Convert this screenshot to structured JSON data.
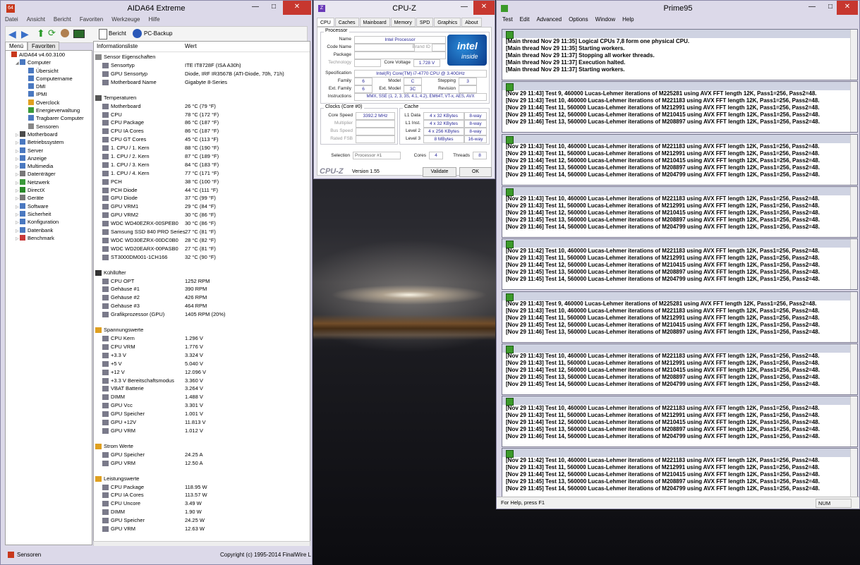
{
  "aida": {
    "title": "AIDA64 Extreme",
    "menu": [
      "Datei",
      "Ansicht",
      "Bericht",
      "Favoriten",
      "Werkzeuge",
      "Hilfe"
    ],
    "toolbar": {
      "report": "Bericht",
      "backup": "PC-Backup"
    },
    "tabs": [
      "Menü",
      "Favoriten"
    ],
    "tree": [
      {
        "label": "AIDA64 v4.60.3100",
        "level": 0,
        "expander": "",
        "color": "#c8381c"
      },
      {
        "label": "Computer",
        "level": 1,
        "expander": "◢",
        "color": "#4a78c0"
      },
      {
        "label": "Übersicht",
        "level": 2,
        "expander": "",
        "color": "#4a78c0"
      },
      {
        "label": "Computername",
        "level": 2,
        "expander": "",
        "color": "#4a78c0"
      },
      {
        "label": "DMI",
        "level": 2,
        "expander": "",
        "color": "#4a78c0"
      },
      {
        "label": "IPMI",
        "level": 2,
        "expander": "",
        "color": "#4a78c0"
      },
      {
        "label": "Overclock",
        "level": 2,
        "expander": "",
        "color": "#e0a020"
      },
      {
        "label": "Energieverwaltung",
        "level": 2,
        "expander": "",
        "color": "#3a9a3a"
      },
      {
        "label": "Tragbarer Computer",
        "level": 2,
        "expander": "",
        "color": "#4a78c0"
      },
      {
        "label": "Sensoren",
        "level": 2,
        "expander": "",
        "color": "#888888"
      },
      {
        "label": "Motherboard",
        "level": 1,
        "expander": "▷",
        "color": "#4a4a4a"
      },
      {
        "label": "Betriebssystem",
        "level": 1,
        "expander": "▷",
        "color": "#4a78c0"
      },
      {
        "label": "Server",
        "level": 1,
        "expander": "▷",
        "color": "#4a78c0"
      },
      {
        "label": "Anzeige",
        "level": 1,
        "expander": "▷",
        "color": "#4a78c0"
      },
      {
        "label": "Multimedia",
        "level": 1,
        "expander": "▷",
        "color": "#4a78c0"
      },
      {
        "label": "Datenträger",
        "level": 1,
        "expander": "▷",
        "color": "#777777"
      },
      {
        "label": "Netzwerk",
        "level": 1,
        "expander": "▷",
        "color": "#3a9a3a"
      },
      {
        "label": "DirectX",
        "level": 1,
        "expander": "▷",
        "color": "#2a8a2a"
      },
      {
        "label": "Geräte",
        "level": 1,
        "expander": "▷",
        "color": "#777777"
      },
      {
        "label": "Software",
        "level": 1,
        "expander": "▷",
        "color": "#4a78c0"
      },
      {
        "label": "Sicherheit",
        "level": 1,
        "expander": "▷",
        "color": "#4a78c0"
      },
      {
        "label": "Konfiguration",
        "level": 1,
        "expander": "▷",
        "color": "#4a78c0"
      },
      {
        "label": "Datenbank",
        "level": 1,
        "expander": "▷",
        "color": "#4a78c0"
      },
      {
        "label": "Benchmark",
        "level": 1,
        "expander": "▷",
        "color": "#c83838"
      }
    ],
    "columns": {
      "name": "Informationsliste",
      "value": "Wert"
    },
    "sections": [
      {
        "title": "Sensor Eigenschaften",
        "color": "#888888",
        "rows": [
          {
            "name": "Sensortyp",
            "value": "ITE IT8728F  (ISA A30h)"
          },
          {
            "name": "GPU Sensortyp",
            "value": "Diode, IRF IR3567B  (ATI-Diode, 70h, 71h)"
          },
          {
            "name": "Motherboard Name",
            "value": "Gigabyte 8-Series"
          }
        ]
      },
      {
        "title": "Temperaturen",
        "color": "#555555",
        "rows": [
          {
            "name": "Motherboard",
            "value": "26 °C  (79 °F)"
          },
          {
            "name": "CPU",
            "value": "78 °C  (172 °F)"
          },
          {
            "name": "CPU Package",
            "value": "86 °C  (187 °F)"
          },
          {
            "name": "CPU IA Cores",
            "value": "86 °C  (187 °F)"
          },
          {
            "name": "CPU GT Cores",
            "value": "45 °C  (113 °F)"
          },
          {
            "name": "1. CPU / 1. Kern",
            "value": "88 °C  (190 °F)"
          },
          {
            "name": "1. CPU / 2. Kern",
            "value": "87 °C  (189 °F)"
          },
          {
            "name": "1. CPU / 3. Kern",
            "value": "84 °C  (183 °F)"
          },
          {
            "name": "1. CPU / 4. Kern",
            "value": "77 °C  (171 °F)"
          },
          {
            "name": "PCH",
            "value": "38 °C  (100 °F)"
          },
          {
            "name": "PCH Diode",
            "value": "44 °C  (111 °F)"
          },
          {
            "name": "GPU Diode",
            "value": "37 °C  (99 °F)"
          },
          {
            "name": "GPU VRM1",
            "value": "29 °C  (84 °F)"
          },
          {
            "name": "GPU VRM2",
            "value": "30 °C  (86 °F)"
          },
          {
            "name": "WDC WD40EZRX-00SPEB0",
            "value": "30 °C  (86 °F)"
          },
          {
            "name": "Samsung SSD 840 PRO Series",
            "value": "27 °C  (81 °F)"
          },
          {
            "name": "WDC WD30EZRX-00DC0B0",
            "value": "28 °C  (82 °F)"
          },
          {
            "name": "WDC WD20EARX-00PASB0",
            "value": "27 °C  (81 °F)"
          },
          {
            "name": "ST3000DM001-1CH166",
            "value": "32 °C  (90 °F)"
          }
        ]
      },
      {
        "title": "Kühllüfter",
        "color": "#333333",
        "rows": [
          {
            "name": "CPU OPT",
            "value": "1252 RPM"
          },
          {
            "name": "Gehäuse #1",
            "value": "390 RPM"
          },
          {
            "name": "Gehäuse #2",
            "value": "426 RPM"
          },
          {
            "name": "Gehäuse #3",
            "value": "464 RPM"
          },
          {
            "name": "Grafikprozessor (GPU)",
            "value": "1405 RPM  (20%)"
          }
        ]
      },
      {
        "title": "Spannungswerte",
        "color": "#e0a020",
        "rows": [
          {
            "name": "CPU Kern",
            "value": "1.296 V"
          },
          {
            "name": "CPU VRM",
            "value": "1.776 V"
          },
          {
            "name": "+3.3 V",
            "value": "3.324 V"
          },
          {
            "name": "+5 V",
            "value": "5.040 V"
          },
          {
            "name": "+12 V",
            "value": "12.096 V"
          },
          {
            "name": "+3.3 V Bereitschaftsmodus",
            "value": "3.360 V"
          },
          {
            "name": "VBAT Batterie",
            "value": "3.264 V"
          },
          {
            "name": "DIMM",
            "value": "1.488 V"
          },
          {
            "name": "GPU Vcc",
            "value": "3.301 V"
          },
          {
            "name": "GPU Speicher",
            "value": "1.001 V"
          },
          {
            "name": "GPU +12V",
            "value": "11.813 V"
          },
          {
            "name": "GPU VRM",
            "value": "1.012 V"
          }
        ]
      },
      {
        "title": "Strom Werte",
        "color": "#e0a020",
        "rows": [
          {
            "name": "GPU Speicher",
            "value": "24.25 A"
          },
          {
            "name": "GPU VRM",
            "value": "12.50 A"
          }
        ]
      },
      {
        "title": "Leistungswerte",
        "color": "#e0a020",
        "rows": [
          {
            "name": "CPU Package",
            "value": "118.95 W"
          },
          {
            "name": "CPU IA Cores",
            "value": "113.57 W"
          },
          {
            "name": "CPU Uncore",
            "value": "3.49 W"
          },
          {
            "name": "DIMM",
            "value": "1.90 W"
          },
          {
            "name": "GPU Speicher",
            "value": "24.25 W"
          },
          {
            "name": "GPU VRM",
            "value": "12.63 W"
          }
        ]
      }
    ],
    "status_left": "Sensoren",
    "status_right": "Copyright (c) 1995-2014 FinalWire L"
  },
  "cpuz": {
    "title": "CPU-Z",
    "tabs": [
      "CPU",
      "Caches",
      "Mainboard",
      "Memory",
      "SPD",
      "Graphics",
      "About"
    ],
    "processor_group": "Processor",
    "name_label": "Name",
    "name": "Intel Processor",
    "codename_label": "Code Name",
    "brand_id_label": "Brand ID",
    "package_label": "Package",
    "technology_label": "Technology",
    "core_voltage_label": "Core Voltage",
    "core_voltage": "1.728 V",
    "spec_label": "Specification",
    "spec": "Intel(R) Core(TM) i7-4770 CPU @ 3.40GHz",
    "family_label": "Family",
    "family": "6",
    "model_label": "Model",
    "model": "C",
    "stepping_label": "Stepping",
    "stepping": "3",
    "ext_family_label": "Ext. Family",
    "ext_family": "6",
    "ext_model_label": "Ext. Model",
    "ext_model": "3C",
    "revision_label": "Revision",
    "instructions_label": "Instructions",
    "instructions": "MMX, SSE (1, 2, 3, 3S, 4.1, 4.2), EM64T, VT-x, AES, AVX",
    "clocks_group": "Clocks (Core #0)",
    "core_speed_label": "Core Speed",
    "core_speed": "3392.2 MHz",
    "multiplier_label": "Multiplier",
    "bus_speed_label": "Bus Speed",
    "rated_fsb_label": "Rated FSB",
    "cache_group": "Cache",
    "l1d_label": "L1 Data",
    "l1d": "4 x 32 KBytes",
    "l1d_way": "8-way",
    "l1i_label": "L1 Inst.",
    "l1i": "4 x 32 KBytes",
    "l1i_way": "8-way",
    "l2_label": "Level 2",
    "l2": "4 x 256 KBytes",
    "l2_way": "8-way",
    "l3_label": "Level 3",
    "l3": "8 MBytes",
    "l3_way": "16-way",
    "selection_label": "Selection",
    "selection": "Processor #1",
    "cores_label": "Cores",
    "cores": "4",
    "threads_label": "Threads",
    "threads": "8",
    "logo": "CPU-Z",
    "version": "Version 1.55",
    "validate": "Validate",
    "ok": "OK",
    "intel_line1": "intel",
    "intel_line2": "inside"
  },
  "prime": {
    "title": "Prime95",
    "menu": [
      "Test",
      "Edit",
      "Advanced",
      "Options",
      "Window",
      "Help"
    ],
    "windows": [
      {
        "lines": [
          "[Main thread Nov 29 11:35] Logical CPUs 7,8 form one physical CPU.",
          "[Main thread Nov 29 11:35] Starting workers.",
          "[Main thread Nov 29 11:37] Stopping all worker threads.",
          "[Main thread Nov 29 11:37] Execution halted.",
          "[Main thread Nov 29 11:37] Starting workers."
        ]
      },
      {
        "lines": [
          "[Nov 29 11:43] Test 9, 460000 Lucas-Lehmer iterations of M225281 using AVX FFT length 12K, Pass1=256, Pass2=48.",
          "[Nov 29 11:43] Test 10, 460000 Lucas-Lehmer iterations of M221183 using AVX FFT length 12K, Pass1=256, Pass2=48.",
          "[Nov 29 11:44] Test 11, 560000 Lucas-Lehmer iterations of M212991 using AVX FFT length 12K, Pass1=256, Pass2=48.",
          "[Nov 29 11:45] Test 12, 560000 Lucas-Lehmer iterations of M210415 using AVX FFT length 12K, Pass1=256, Pass2=48.",
          "[Nov 29 11:46] Test 13, 560000 Lucas-Lehmer iterations of M208897 using AVX FFT length 12K, Pass1=256, Pass2=48."
        ]
      },
      {
        "lines": [
          "[Nov 29 11:43] Test 10, 460000 Lucas-Lehmer iterations of M221183 using AVX FFT length 12K, Pass1=256, Pass2=48.",
          "[Nov 29 11:43] Test 11, 560000 Lucas-Lehmer iterations of M212991 using AVX FFT length 12K, Pass1=256, Pass2=48.",
          "[Nov 29 11:44] Test 12, 560000 Lucas-Lehmer iterations of M210415 using AVX FFT length 12K, Pass1=256, Pass2=48.",
          "[Nov 29 11:45] Test 13, 560000 Lucas-Lehmer iterations of M208897 using AVX FFT length 12K, Pass1=256, Pass2=48.",
          "[Nov 29 11:46] Test 14, 560000 Lucas-Lehmer iterations of M204799 using AVX FFT length 12K, Pass1=256, Pass2=48."
        ]
      },
      {
        "lines": [
          "[Nov 29 11:43] Test 10, 460000 Lucas-Lehmer iterations of M221183 using AVX FFT length 12K, Pass1=256, Pass2=48.",
          "[Nov 29 11:43] Test 11, 560000 Lucas-Lehmer iterations of M212991 using AVX FFT length 12K, Pass1=256, Pass2=48.",
          "[Nov 29 11:44] Test 12, 560000 Lucas-Lehmer iterations of M210415 using AVX FFT length 12K, Pass1=256, Pass2=48.",
          "[Nov 29 11:45] Test 13, 560000 Lucas-Lehmer iterations of M208897 using AVX FFT length 12K, Pass1=256, Pass2=48.",
          "[Nov 29 11:46] Test 14, 560000 Lucas-Lehmer iterations of M204799 using AVX FFT length 12K, Pass1=256, Pass2=48."
        ]
      },
      {
        "lines": [
          "[Nov 29 11:42] Test 10, 460000 Lucas-Lehmer iterations of M221183 using AVX FFT length 12K, Pass1=256, Pass2=48.",
          "[Nov 29 11:43] Test 11, 560000 Lucas-Lehmer iterations of M212991 using AVX FFT length 12K, Pass1=256, Pass2=48.",
          "[Nov 29 11:44] Test 12, 560000 Lucas-Lehmer iterations of M210415 using AVX FFT length 12K, Pass1=256, Pass2=48.",
          "[Nov 29 11:45] Test 13, 560000 Lucas-Lehmer iterations of M208897 using AVX FFT length 12K, Pass1=256, Pass2=48.",
          "[Nov 29 11:45] Test 14, 560000 Lucas-Lehmer iterations of M204799 using AVX FFT length 12K, Pass1=256, Pass2=48."
        ]
      },
      {
        "lines": [
          "[Nov 29 11:43] Test 9, 460000 Lucas-Lehmer iterations of M225281 using AVX FFT length 12K, Pass1=256, Pass2=48.",
          "[Nov 29 11:43] Test 10, 460000 Lucas-Lehmer iterations of M221183 using AVX FFT length 12K, Pass1=256, Pass2=48.",
          "[Nov 29 11:44] Test 11, 560000 Lucas-Lehmer iterations of M212991 using AVX FFT length 12K, Pass1=256, Pass2=48.",
          "[Nov 29 11:45] Test 12, 560000 Lucas-Lehmer iterations of M210415 using AVX FFT length 12K, Pass1=256, Pass2=48.",
          "[Nov 29 11:46] Test 13, 560000 Lucas-Lehmer iterations of M208897 using AVX FFT length 12K, Pass1=256, Pass2=48."
        ]
      },
      {
        "lines": [
          "[Nov 29 11:43] Test 10, 460000 Lucas-Lehmer iterations of M221183 using AVX FFT length 12K, Pass1=256, Pass2=48.",
          "[Nov 29 11:43] Test 11, 560000 Lucas-Lehmer iterations of M212991 using AVX FFT length 12K, Pass1=256, Pass2=48.",
          "[Nov 29 11:44] Test 12, 560000 Lucas-Lehmer iterations of M210415 using AVX FFT length 12K, Pass1=256, Pass2=48.",
          "[Nov 29 11:45] Test 13, 560000 Lucas-Lehmer iterations of M208897 using AVX FFT length 12K, Pass1=256, Pass2=48.",
          "[Nov 29 11:45] Test 14, 560000 Lucas-Lehmer iterations of M204799 using AVX FFT length 12K, Pass1=256, Pass2=48."
        ]
      },
      {
        "lines": [
          "[Nov 29 11:43] Test 10, 460000 Lucas-Lehmer iterations of M221183 using AVX FFT length 12K, Pass1=256, Pass2=48.",
          "[Nov 29 11:43] Test 11, 560000 Lucas-Lehmer iterations of M212991 using AVX FFT length 12K, Pass1=256, Pass2=48.",
          "[Nov 29 11:44] Test 12, 560000 Lucas-Lehmer iterations of M210415 using AVX FFT length 12K, Pass1=256, Pass2=48.",
          "[Nov 29 11:45] Test 13, 560000 Lucas-Lehmer iterations of M208897 using AVX FFT length 12K, Pass1=256, Pass2=48.",
          "[Nov 29 11:46] Test 14, 560000 Lucas-Lehmer iterations of M204799 using AVX FFT length 12K, Pass1=256, Pass2=48."
        ]
      },
      {
        "lines": [
          "[Nov 29 11:42] Test 10, 460000 Lucas-Lehmer iterations of M221183 using AVX FFT length 12K, Pass1=256, Pass2=48.",
          "[Nov 29 11:43] Test 11, 560000 Lucas-Lehmer iterations of M212991 using AVX FFT length 12K, Pass1=256, Pass2=48.",
          "[Nov 29 11:44] Test 12, 560000 Lucas-Lehmer iterations of M210415 using AVX FFT length 12K, Pass1=256, Pass2=48.",
          "[Nov 29 11:45] Test 13, 560000 Lucas-Lehmer iterations of M208897 using AVX FFT length 12K, Pass1=256, Pass2=48.",
          "[Nov 29 11:45] Test 14, 560000 Lucas-Lehmer iterations of M204799 using AVX FFT length 12K, Pass1=256, Pass2=48."
        ]
      }
    ],
    "status": "For Help, press F1",
    "num": "NUM"
  }
}
